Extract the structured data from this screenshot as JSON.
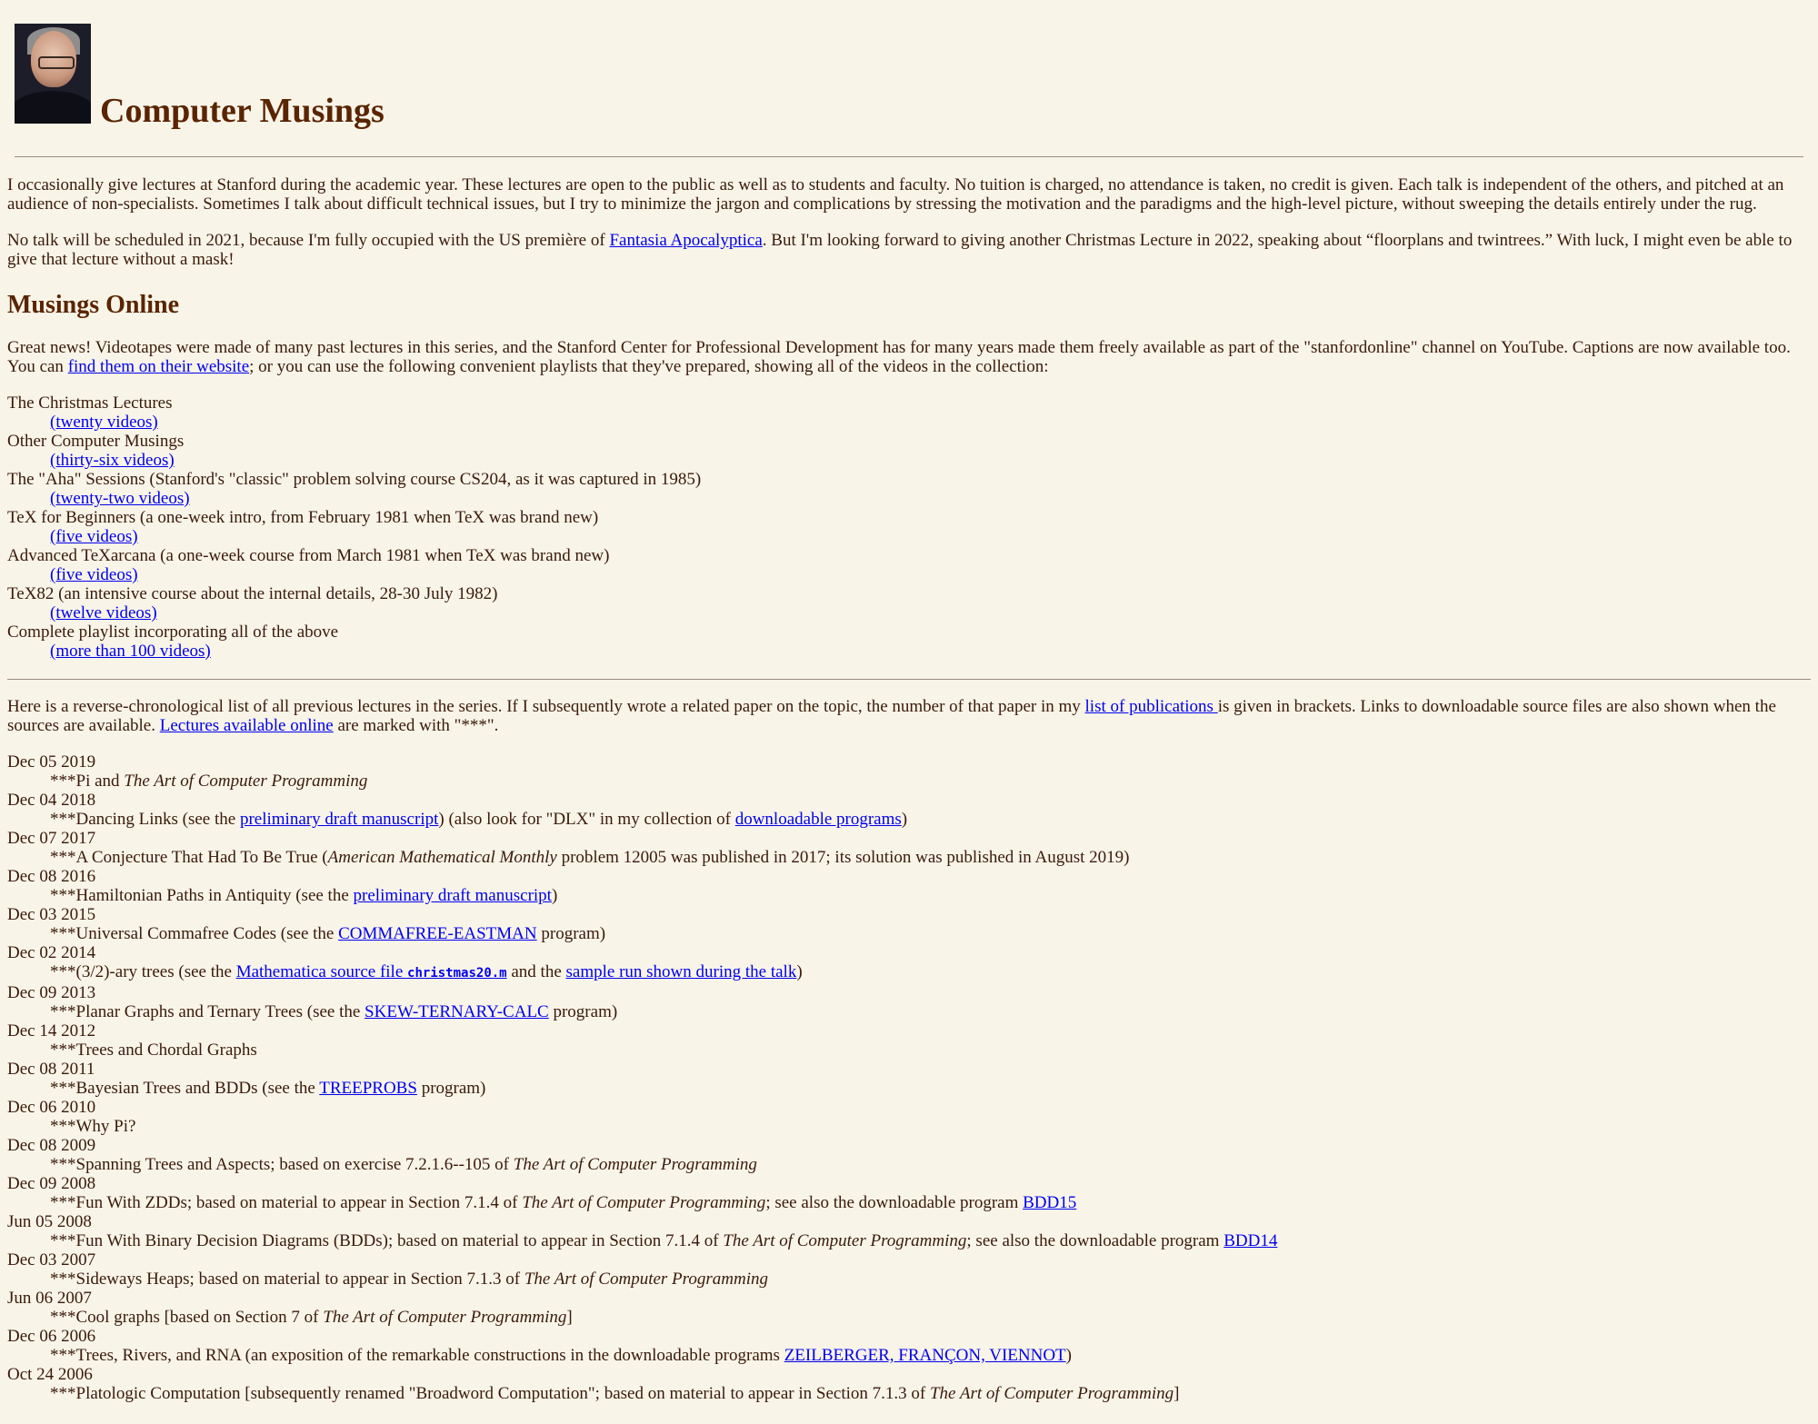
{
  "title": "Computer Musings",
  "intro1": "I occasionally give lectures at Stanford during the academic year. These lectures are open to the public as well as to students and faculty. No tuition is charged, no attendance is taken, no credit is given. Each talk is independent of the others, and pitched at an audience of non-specialists. Sometimes I talk about difficult technical issues, but I try to minimize the jargon and complications by stressing the motivation and the paradigms and the high-level picture, without sweeping the details entirely under the rug.",
  "intro2": {
    "before": "No talk will be scheduled in 2021, because I'm fully occupied with the US première of ",
    "link": "Fantasia Apocalyptica",
    "after": ". But I'm looking forward to giving another Christmas Lecture in 2022, speaking about “floorplans and twintrees.” With luck, I might even be able to give that lecture without a mask!"
  },
  "online": {
    "heading": "Musings Online",
    "text_before": "Great news! Videotapes were made of many past lectures in this series, and the Stanford Center for Professional Development has for many years made them freely available as part of the \"stanfordonline\" channel on YouTube. Captions are now available too. You can ",
    "link": "find them on their website",
    "text_after": "; or you can use the following convenient playlists that they've prepared, showing all of the videos in the collection:",
    "playlists": [
      {
        "title": "The Christmas Lectures",
        "link": "(twenty videos)"
      },
      {
        "title": "Other Computer Musings",
        "link": "(thirty-six videos)"
      },
      {
        "title": "The \"Aha\" Sessions (Stanford's \"classic\" problem solving course CS204, as it was captured in 1985)",
        "link": "(twenty-two videos)"
      },
      {
        "title": "TeX for Beginners (a one-week intro, from February 1981 when TeX was brand new)",
        "link": "(five videos)"
      },
      {
        "title": "Advanced TeXarcana (a one-week course from March 1981 when TeX was brand new)",
        "link": "(five videos)"
      },
      {
        "title": "TeX82 (an intensive course about the internal details, 28-30 July 1982)",
        "link": "(twelve videos)"
      },
      {
        "title": "Complete playlist incorporating all of the above",
        "link": "(more than 100 videos)"
      }
    ]
  },
  "list_intro": {
    "t1": "Here is a reverse-chronological list of all previous lectures in the series. If I subsequently wrote a related paper on the topic, the number of that paper in my ",
    "link1": "list of publications ",
    "t2": "is given in brackets. Links to downloadable source files are also shown when the sources are available. ",
    "link2": "Lectures available online",
    "t3": " are marked with \"***\"."
  },
  "lectures": [
    {
      "date": "Dec 05 2019",
      "parts": [
        {
          "t": "***Pi and "
        },
        {
          "i": "The Art of Computer Programming"
        }
      ]
    },
    {
      "date": "Dec 04 2018",
      "parts": [
        {
          "t": "***Dancing Links (see the "
        },
        {
          "a": "preliminary draft manuscript"
        },
        {
          "t": ") (also look for \"DLX\" in my collection of "
        },
        {
          "a": "downloadable programs"
        },
        {
          "t": ")"
        }
      ]
    },
    {
      "date": "Dec 07 2017",
      "parts": [
        {
          "t": "***A Conjecture That Had To Be True ("
        },
        {
          "i": "American Mathematical Monthly"
        },
        {
          "t": " problem 12005 was published in 2017; its solution was published in August 2019)"
        }
      ]
    },
    {
      "date": "Dec 08 2016",
      "parts": [
        {
          "t": "***Hamiltonian Paths in Antiquity (see the "
        },
        {
          "a": "preliminary draft manuscript"
        },
        {
          "t": ")"
        }
      ]
    },
    {
      "date": "Dec 03 2015",
      "parts": [
        {
          "t": "***Universal Commafree Codes (see the "
        },
        {
          "a": "COMMAFREE-EASTMAN"
        },
        {
          "t": " program)"
        }
      ]
    },
    {
      "date": "Dec 02 2014",
      "parts": [
        {
          "t": "***(3/2)-ary trees (see the "
        },
        {
          "a": "Mathematica source file ",
          "code": "christmas20.m"
        },
        {
          "t": " and the "
        },
        {
          "a": "sample run shown during the talk"
        },
        {
          "t": ")"
        }
      ]
    },
    {
      "date": "Dec 09 2013",
      "parts": [
        {
          "t": "***Planar Graphs and Ternary Trees (see the "
        },
        {
          "a": "SKEW-TERNARY-CALC"
        },
        {
          "t": " program)"
        }
      ]
    },
    {
      "date": "Dec 14 2012",
      "parts": [
        {
          "t": "***Trees and Chordal Graphs"
        }
      ]
    },
    {
      "date": "Dec 08 2011",
      "parts": [
        {
          "t": "***Bayesian Trees and BDDs (see the "
        },
        {
          "a": "TREEPROBS"
        },
        {
          "t": " program)"
        }
      ]
    },
    {
      "date": "Dec 06 2010",
      "parts": [
        {
          "t": "***Why Pi?"
        }
      ]
    },
    {
      "date": "Dec 08 2009",
      "parts": [
        {
          "t": "***Spanning Trees and Aspects; based on exercise 7.2.1.6--105 of "
        },
        {
          "i": "The Art of Computer Programming"
        }
      ]
    },
    {
      "date": "Dec 09 2008",
      "parts": [
        {
          "t": "***Fun With ZDDs; based on material to appear in Section 7.1.4 of "
        },
        {
          "i": "The Art of Computer Programming"
        },
        {
          "t": "; see also the downloadable program "
        },
        {
          "a": "BDD15"
        }
      ]
    },
    {
      "date": "Jun 05 2008",
      "parts": [
        {
          "t": "***Fun With Binary Decision Diagrams (BDDs); based on material to appear in Section 7.1.4 of "
        },
        {
          "i": "The Art of Computer Programming"
        },
        {
          "t": "; see also the downloadable program "
        },
        {
          "a": "BDD14"
        }
      ]
    },
    {
      "date": "Dec 03 2007",
      "parts": [
        {
          "t": "***Sideways Heaps; based on material to appear in Section 7.1.3 of "
        },
        {
          "i": "The Art of Computer Programming"
        }
      ]
    },
    {
      "date": "Jun 06 2007",
      "parts": [
        {
          "t": "***Cool graphs [based on Section 7 of "
        },
        {
          "i": "The Art of Computer Programming"
        },
        {
          "t": "]"
        }
      ]
    },
    {
      "date": "Dec 06 2006",
      "parts": [
        {
          "t": "***Trees, Rivers, and RNA (an exposition of the remarkable constructions in the downloadable programs "
        },
        {
          "a": "ZEILBERGER, FRANÇON, VIENNOT"
        },
        {
          "t": ")"
        }
      ]
    },
    {
      "date": "Oct 24 2006",
      "parts": [
        {
          "t": "***Platologic Computation [subsequently renamed \"Broadword Computation\"; based on material to appear in Section 7.1.3 of "
        },
        {
          "i": "The Art of Computer Programming"
        },
        {
          "t": "]"
        }
      ]
    }
  ]
}
